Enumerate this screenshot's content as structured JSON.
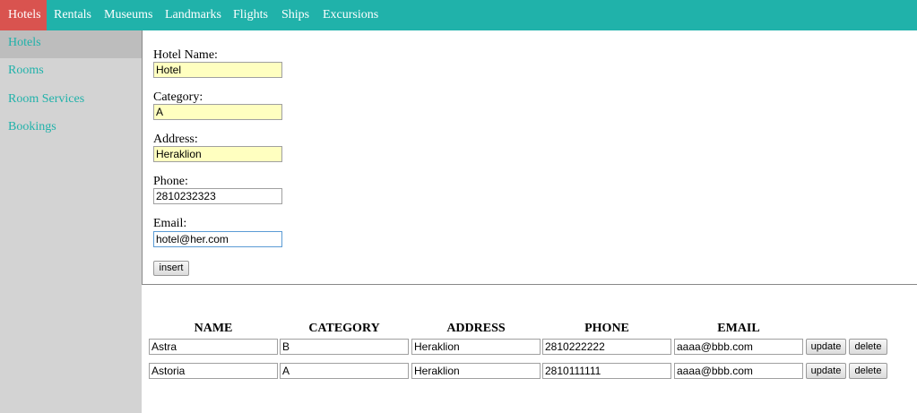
{
  "topnav": {
    "items": [
      "Hotels",
      "Rentals",
      "Museums",
      "Landmarks",
      "Flights",
      "Ships",
      "Excursions"
    ]
  },
  "sidebar": {
    "items": [
      "Hotels",
      "Rooms",
      "Room Services",
      "Bookings"
    ]
  },
  "form": {
    "hotel_name_label": "Hotel Name:",
    "hotel_name_value": "Hotel",
    "category_label": "Category:",
    "category_value": "A",
    "address_label": "Address:",
    "address_value": "Heraklion",
    "phone_label": "Phone:",
    "phone_value": "2810232323",
    "email_label": "Email:",
    "email_value": "hotel@her.com",
    "insert_label": "insert"
  },
  "table": {
    "headers": [
      "NAME",
      "CATEGORY",
      "ADDRESS",
      "PHONE",
      "EMAIL"
    ],
    "rows": [
      {
        "name": "Astra",
        "category": "B",
        "address": "Heraklion",
        "phone": "2810222222",
        "email": "aaaa@bbb.com"
      },
      {
        "name": "Astoria",
        "category": "A",
        "address": "Heraklion",
        "phone": "2810111111",
        "email": "aaaa@bbb.com"
      }
    ],
    "update_label": "update",
    "delete_label": "delete"
  },
  "colors": {
    "nav_bg": "#20b2aa",
    "nav_active": "#d9534f",
    "sidebar_bg": "#d3d3d3",
    "sidebar_link": "#20b2aa",
    "autofill_bg": "#ffffc0"
  }
}
